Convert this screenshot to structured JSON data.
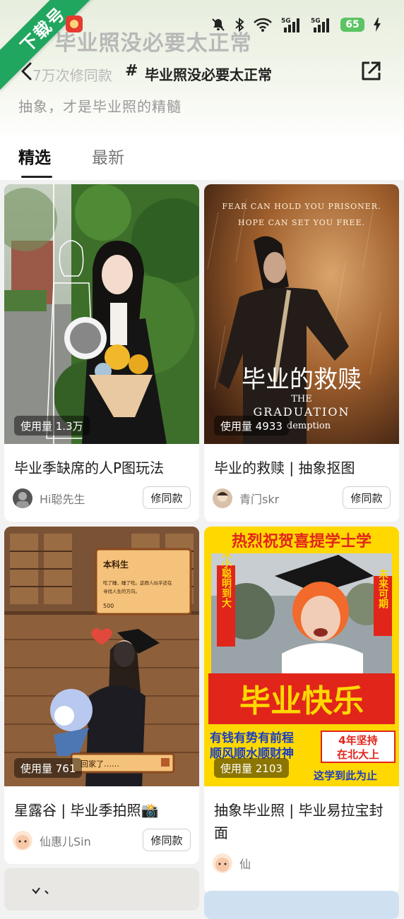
{
  "status_bar": {
    "battery": "65",
    "net1": "5G",
    "net2": "5G"
  },
  "ribbon": {
    "label": "下载号"
  },
  "header": {
    "big_title": "# 毕业照没必要太正常",
    "usage_faded": "7万次修同款",
    "hashtag": "#",
    "title": "毕业照没必要太正常",
    "subtitle": "抽象，才是毕业照的精髓"
  },
  "tabs": [
    {
      "label": "精选",
      "active": true
    },
    {
      "label": "最新",
      "active": false
    }
  ],
  "remake_label": "修同款",
  "cards": [
    {
      "usage": "使用量 1.3万",
      "title": "毕业季缺席的人P图玩法",
      "author": "Hi聪先生"
    },
    {
      "usage": "使用量 4933",
      "title": "毕业的救赎 | 抽象抠图",
      "author": "青门skr",
      "poster": {
        "top_line1": "FEAR CAN HOLD YOU PRISONER.",
        "top_line2": "HOPE CAN SET YOU FREE.",
        "cn_title": "毕业的救赎",
        "en_line1": "THE",
        "en_line2": "GRADUATION",
        "en_line3": "demption"
      }
    },
    {
      "usage": "使用量 761",
      "title": "星露谷 | 毕业季拍照📸",
      "author": "仙惠儿Sin",
      "game": {
        "box_title": "本科生",
        "box_text1": "吃了睡，睡了吃。这群人似乎还在",
        "box_text2": "寻找人生的方向。",
        "money": "500",
        "dialog": "回家了……"
      }
    },
    {
      "usage": "使用量 2103",
      "title": "抽象毕业照 | 毕业易拉宝封面",
      "author": "仙",
      "poster": {
        "banner": "热烈祝贺喜提学士学",
        "left_vertical": "从小聪明到大",
        "right_vertical": "未来可期",
        "big": "毕业快乐",
        "line1": "有钱有势有前程",
        "line2": "顺风顺水顺财神",
        "box1": "4年坚持",
        "box2": "在北大上",
        "bottom": "这学到此为止"
      }
    }
  ],
  "colors": {
    "ribbon": "#21a65f",
    "battery": "#5cc463",
    "poster_red": "#e1251b",
    "poster_yellow": "#ffd800"
  }
}
